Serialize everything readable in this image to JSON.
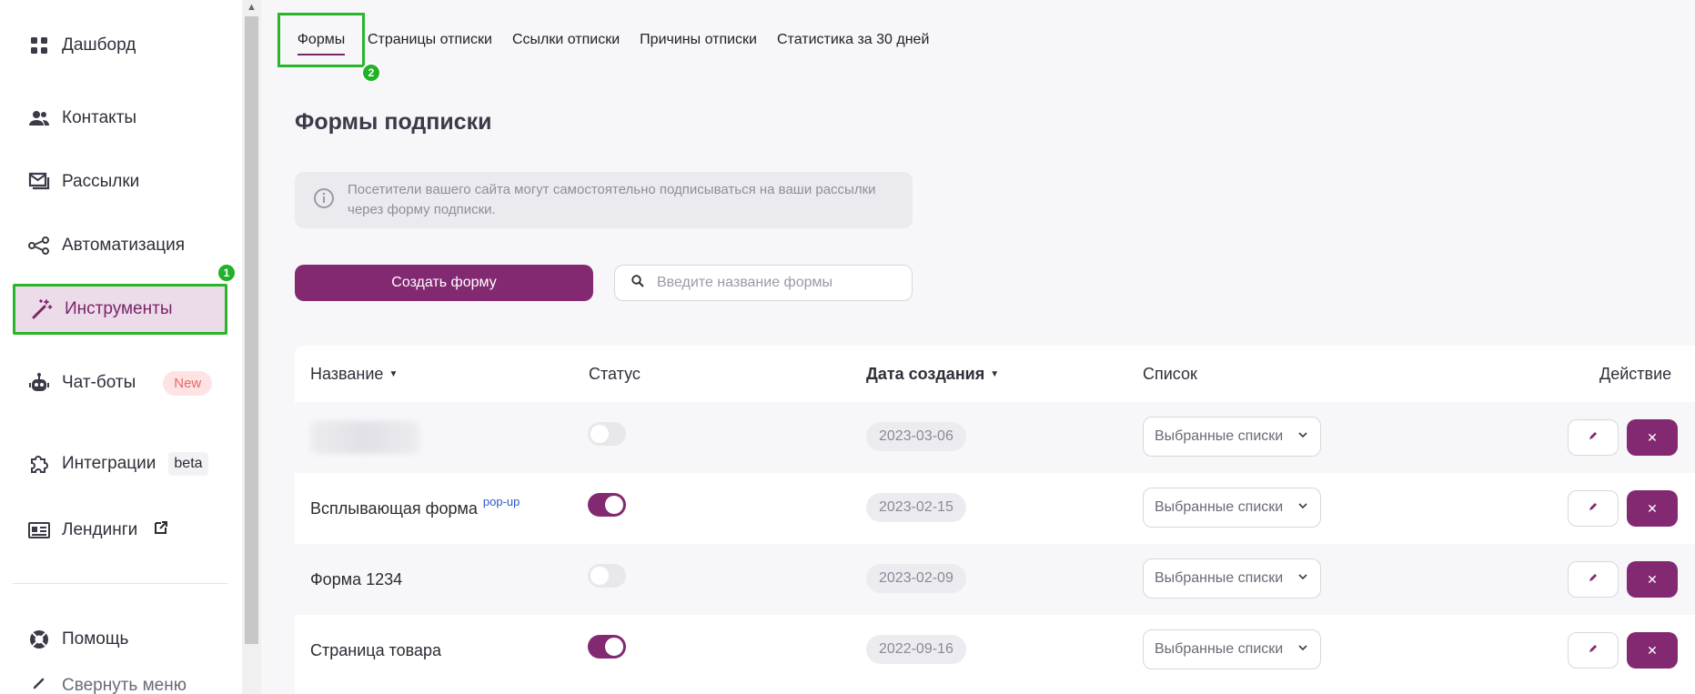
{
  "sidebar": {
    "items": [
      {
        "label": "Дашборд",
        "icon": "dashboard-grid-icon"
      },
      {
        "label": "Контакты",
        "icon": "contacts-people-icon"
      },
      {
        "label": "Рассылки",
        "icon": "mail-inbox-icon"
      },
      {
        "label": "Автоматизация",
        "icon": "automation-nodes-icon"
      },
      {
        "label": "Инструменты",
        "icon": "magic-wand-icon",
        "active": true
      },
      {
        "label": "Чат-боты",
        "icon": "robot-icon",
        "badge": "New"
      },
      {
        "label": "Интеграции",
        "icon": "puzzle-icon",
        "badge": "beta"
      },
      {
        "label": "Лендинги",
        "icon": "landing-card-icon"
      },
      {
        "label": "Помощь",
        "icon": "lifebuoy-icon"
      },
      {
        "label": "Свернуть меню",
        "icon": "collapse-icon"
      }
    ]
  },
  "markers": {
    "sidebar": "1",
    "tab": "2"
  },
  "tabs": [
    {
      "label": "Формы",
      "active": true
    },
    {
      "label": "Страницы отписки"
    },
    {
      "label": "Ссылки отписки"
    },
    {
      "label": "Причины отписки"
    },
    {
      "label": "Статистика за 30 дней"
    }
  ],
  "page": {
    "title": "Формы подписки",
    "info": "Посетители вашего сайта могут самостоятельно подписываться на ваши рассылки через форму подписки.",
    "create_button": "Создать форму",
    "search_placeholder": "Введите название формы"
  },
  "table": {
    "headers": {
      "name": "Название",
      "status": "Статус",
      "created": "Дата создания",
      "list": "Список",
      "action": "Действие"
    },
    "rows": [
      {
        "name": "",
        "blurred": true,
        "tag": "",
        "status": false,
        "date": "2023-03-06",
        "list": "Выбранные списки"
      },
      {
        "name": "Всплывающая форма",
        "tag": "pop-up",
        "status": true,
        "date": "2023-02-15",
        "list": "Выбранные списки"
      },
      {
        "name": "Форма 1234",
        "tag": "",
        "status": false,
        "date": "2023-02-09",
        "list": "Выбранные списки"
      },
      {
        "name": "Страница товара",
        "tag": "",
        "status": true,
        "date": "2022-09-16",
        "list": "Выбранные списки"
      }
    ]
  },
  "colors": {
    "accent": "#832971",
    "active_bg": "#ecdbe9",
    "highlight": "#2ab52a"
  }
}
